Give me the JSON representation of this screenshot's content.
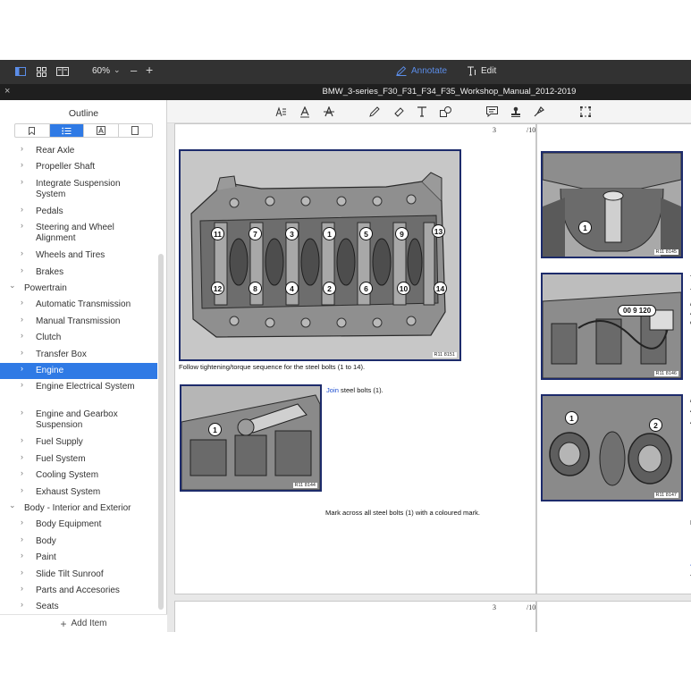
{
  "toolbar": {
    "zoom": "60%",
    "annotate_label": "Annotate",
    "edit_label": "Edit",
    "accent_color": "#5b8de8"
  },
  "window": {
    "title": "BMW_3-series_F30_F31_F34_F35_Workshop_Manual_2012-2019"
  },
  "sidebar": {
    "title": "Outline",
    "selected_tab": "outline-list",
    "items": [
      {
        "label": "Rear Axle",
        "level": 1,
        "expanded": false,
        "selected": false
      },
      {
        "label": "Propeller Shaft",
        "level": 1,
        "expanded": false,
        "selected": false
      },
      {
        "label": "Integrate Suspension System",
        "level": 1,
        "expanded": false,
        "selected": false
      },
      {
        "label": "Pedals",
        "level": 1,
        "expanded": false,
        "selected": false
      },
      {
        "label": "Steering and Wheel Alignment",
        "level": 1,
        "expanded": false,
        "selected": false
      },
      {
        "label": "Wheels and Tires",
        "level": 1,
        "expanded": false,
        "selected": false
      },
      {
        "label": "Brakes",
        "level": 1,
        "expanded": false,
        "selected": false
      },
      {
        "label": "Powertrain",
        "level": 0,
        "expanded": true,
        "selected": false
      },
      {
        "label": "Automatic Transmission",
        "level": 1,
        "expanded": false,
        "selected": false
      },
      {
        "label": "Manual Transmission",
        "level": 1,
        "expanded": false,
        "selected": false
      },
      {
        "label": "Clutch",
        "level": 1,
        "expanded": false,
        "selected": false
      },
      {
        "label": "Transfer Box",
        "level": 1,
        "expanded": false,
        "selected": false
      },
      {
        "label": "Engine",
        "level": 1,
        "expanded": false,
        "selected": true
      },
      {
        "label": "Engine Electrical System",
        "level": 1,
        "expanded": false,
        "selected": false
      },
      {
        "label": "Engine and Gearbox Suspension",
        "level": 1,
        "expanded": false,
        "selected": false
      },
      {
        "label": "Fuel Supply",
        "level": 1,
        "expanded": false,
        "selected": false
      },
      {
        "label": "Fuel System",
        "level": 1,
        "expanded": false,
        "selected": false
      },
      {
        "label": "Cooling System",
        "level": 1,
        "expanded": false,
        "selected": false
      },
      {
        "label": "Exhaust System",
        "level": 1,
        "expanded": false,
        "selected": false
      },
      {
        "label": "Body - Interior and Exterior",
        "level": 0,
        "expanded": true,
        "selected": false
      },
      {
        "label": "Body Equipment",
        "level": 1,
        "expanded": false,
        "selected": false
      },
      {
        "label": "Body",
        "level": 1,
        "expanded": false,
        "selected": false
      },
      {
        "label": "Paint",
        "level": 1,
        "expanded": false,
        "selected": false
      },
      {
        "label": "Slide Tilt Sunroof",
        "level": 1,
        "expanded": false,
        "selected": false
      },
      {
        "label": "Parts and Accesories",
        "level": 1,
        "expanded": false,
        "selected": false
      },
      {
        "label": "Seats",
        "level": 1,
        "expanded": false,
        "selected": false
      }
    ],
    "add_item_label": "Add Item",
    "selection_color": "#2f7ae5"
  },
  "document": {
    "page_left": {
      "page_number": "3",
      "page_total": "/10",
      "figure_main_id": "R11 8151",
      "figure_main_callouts_top": [
        "11",
        "7",
        "3",
        "1",
        "5",
        "9",
        "13"
      ],
      "figure_main_callouts_bottom": [
        "12",
        "8",
        "4",
        "2",
        "6",
        "10",
        "14"
      ],
      "caption_main": "Follow tightening/torque sequence for the steel bolts (1 to 14).",
      "figure_small_id": "R11 8144",
      "figure_small_callout": "1",
      "join_link": "Join",
      "join_text": " steel bolts (1).",
      "mark_text": "Mark across all steel bolts (1) with a coloured mark."
    },
    "page_right": {
      "figures": [
        {
          "id": "R11 8145",
          "callouts": [
            "1"
          ]
        },
        {
          "id": "R11 8146",
          "callouts": [],
          "tool_badge": "00 9 120"
        },
        {
          "id": "R11 8147",
          "callouts": [
            "1",
            "2"
          ]
        }
      ],
      "edge_chars": [
        "T",
        "T",
        "/",
        "A",
        "c",
        "/",
        "A",
        "A",
        "N",
        "J",
        "T"
      ]
    },
    "next_page": {
      "page_number": "3",
      "page_total": "/10"
    }
  }
}
